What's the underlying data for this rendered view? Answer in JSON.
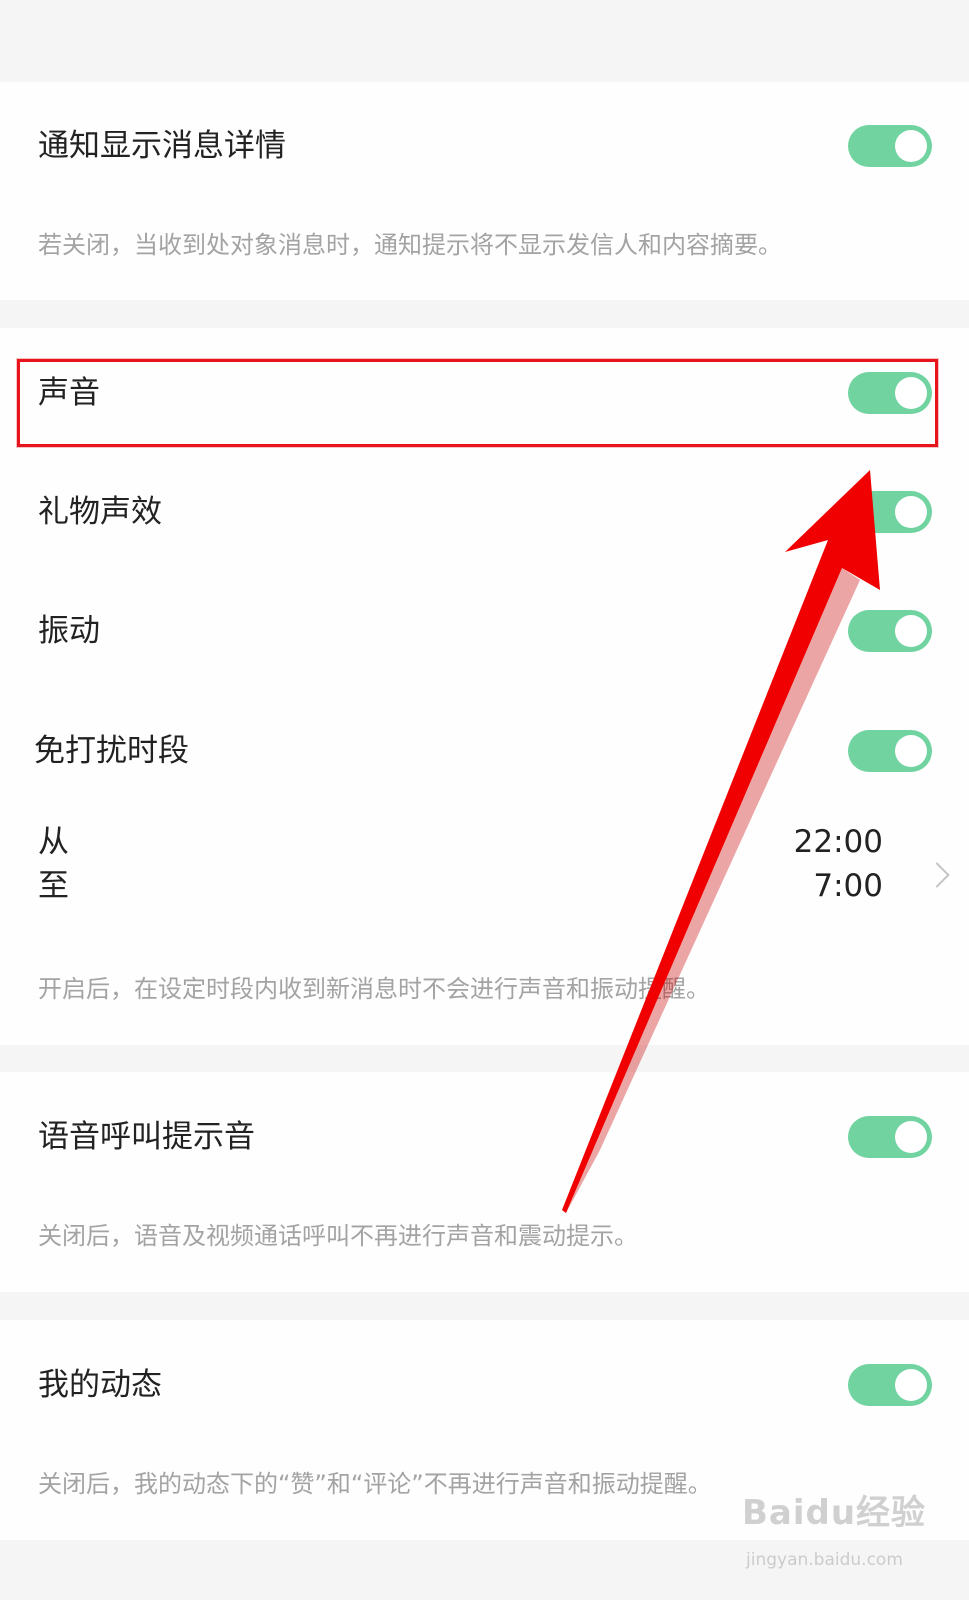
{
  "sections": {
    "notification_detail": {
      "label": "通知显示消息详情",
      "description": "若关闭，当收到处对象消息时，通知提示将不显示发信人和内容摘要。",
      "enabled": true
    },
    "sound": {
      "label": "声音",
      "enabled": true
    },
    "gift_sound": {
      "label": "礼物声效",
      "enabled": true
    },
    "vibration": {
      "label": "振动",
      "enabled": true
    },
    "dnd": {
      "label": "免打扰时段",
      "enabled": true,
      "from_label": "从",
      "from_value": "22:00",
      "to_label": "至",
      "to_value": "7:00",
      "description": "开启后，在设定时段内收到新消息时不会进行声音和振动提醒。"
    },
    "voice_call_tone": {
      "label": "语音呼叫提示音",
      "description": "关闭后，语音及视频通话呼叫不再进行声音和震动提示。",
      "enabled": true
    },
    "my_moments": {
      "label": "我的动态",
      "description": "关闭后，我的动态下的“赞”和“评论”不再进行声音和振动提醒。",
      "enabled": true
    }
  },
  "watermark": {
    "text": "Baidu经验",
    "url": "jingyan.baidu.com"
  },
  "colors": {
    "toggle_on": "#70d3a0",
    "highlight": "#e8141b",
    "arrow": "#f00000"
  },
  "icons": [
    "chevron-right-icon",
    "red-arrow-annotation"
  ]
}
